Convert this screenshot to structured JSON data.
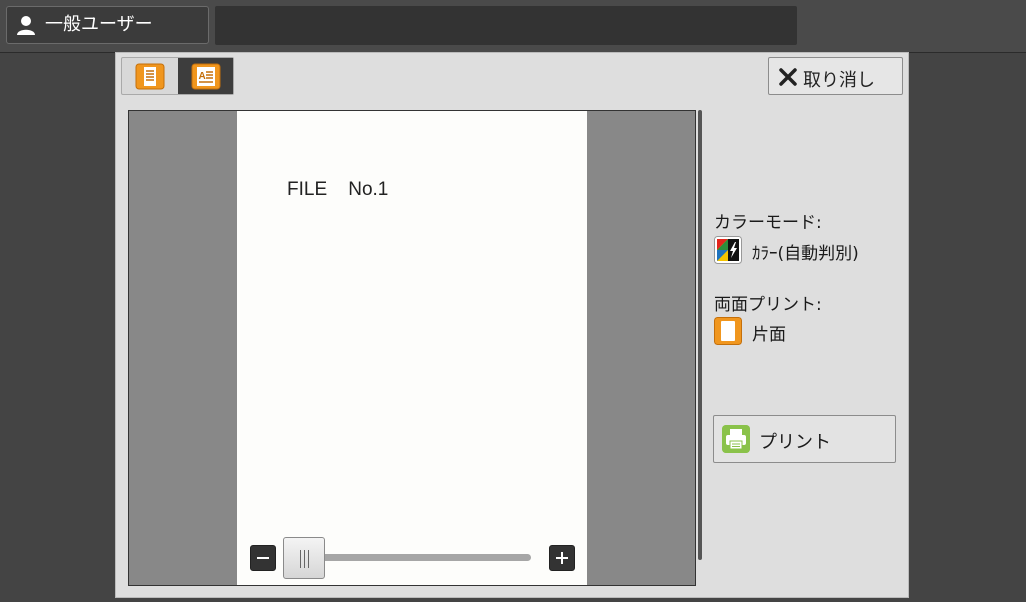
{
  "header": {
    "user_label": "一般ユーザー",
    "user_icon": "person-icon",
    "message": ""
  },
  "dialog": {
    "view_modes": [
      {
        "icon": "document-page-icon",
        "selected": false
      },
      {
        "icon": "document-text-icon",
        "selected": true
      }
    ],
    "cancel_label": "取り消し",
    "cancel_icon": "close-icon",
    "preview": {
      "page_text": "FILE    No.1",
      "zoom_level": 0,
      "zoom_minus_icon": "minus-icon",
      "zoom_plus_icon": "plus-icon"
    },
    "settings": {
      "color_mode_label": "カラーモード:",
      "color_mode_value": "ｶﾗｰ(自動判別)",
      "color_mode_icon": "color-auto-icon",
      "duplex_label": "両面プリント:",
      "duplex_value": "片面",
      "duplex_icon": "single-sided-icon"
    },
    "print_label": "プリント",
    "print_icon": "printer-icon"
  },
  "colors": {
    "accent_orange": "#f0961e",
    "print_green": "#8ac24a"
  }
}
